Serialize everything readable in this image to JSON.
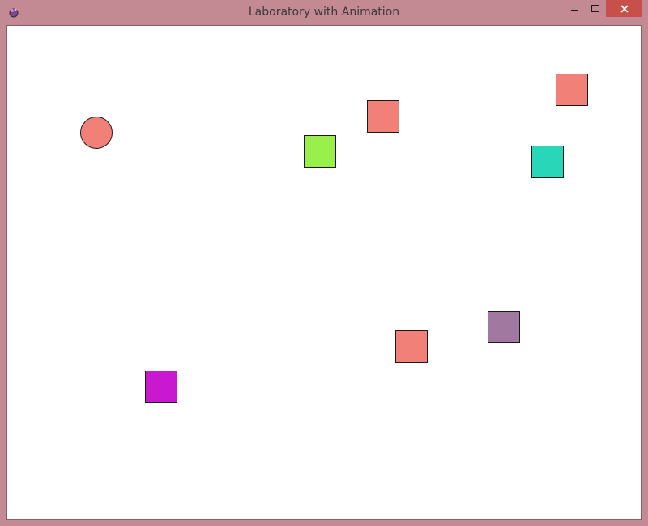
{
  "window": {
    "title": "Laboratory with Animation",
    "frame_color": "#c48a93",
    "close_button_color": "#c7504b",
    "controls": [
      "minimize-icon",
      "maximize-icon",
      "close-icon"
    ]
  },
  "canvas": {
    "background": "#ffffff",
    "shapes": [
      {
        "kind": "circle",
        "color": "#f08078"
      },
      {
        "kind": "square",
        "color": "#9af04a"
      },
      {
        "kind": "square",
        "color": "#f08078"
      },
      {
        "kind": "square",
        "color": "#f08078"
      },
      {
        "kind": "square",
        "color": "#2ad6b8"
      },
      {
        "kind": "square",
        "color": "#a078a0"
      },
      {
        "kind": "square",
        "color": "#f08078"
      },
      {
        "kind": "square",
        "color": "#c818d0"
      }
    ]
  }
}
